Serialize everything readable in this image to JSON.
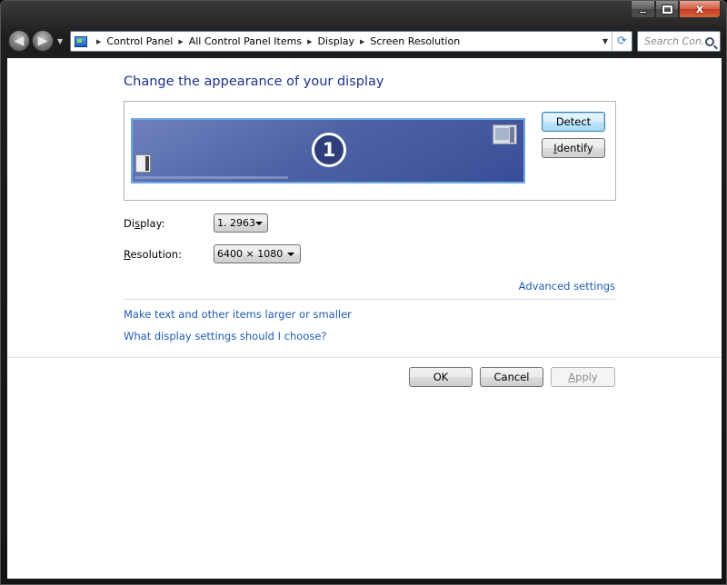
{
  "window": {
    "caption_buttons": {
      "minimize": "–",
      "maximize": "□",
      "close": "x"
    }
  },
  "navigation": {
    "back_icon": "back-arrow-icon",
    "forward_icon": "forward-arrow-icon",
    "breadcrumbs": [
      "Control Panel",
      "All Control Panel Items",
      "Display",
      "Screen Resolution"
    ],
    "search_placeholder": "Search Con..."
  },
  "page": {
    "title": "Change the appearance of your display",
    "monitor_number": "1",
    "detect_button": "Detect",
    "identify_button_prefix": "",
    "identify_button_mnemonic": "I",
    "identify_button_rest": "dentify",
    "display_label_prefix": "Di",
    "display_label_mnemonic": "s",
    "display_label_rest": "play:",
    "display_value": "1. 2963",
    "resolution_label_prefix": "",
    "resolution_label_mnemonic": "R",
    "resolution_label_rest": "esolution:",
    "resolution_value": "6400 × 1080",
    "advanced_settings_link": "Advanced settings",
    "text_size_link": "Make text and other items larger or smaller",
    "what_settings_link": "What display settings should I choose?",
    "ok_button": "OK",
    "cancel_button": "Cancel",
    "apply_button_mnemonic": "A",
    "apply_button_rest": "pply"
  },
  "colors": {
    "title_blue": "#1e3287",
    "link_blue": "#1e5bb5",
    "monitor_fill": "#4e63a6"
  }
}
